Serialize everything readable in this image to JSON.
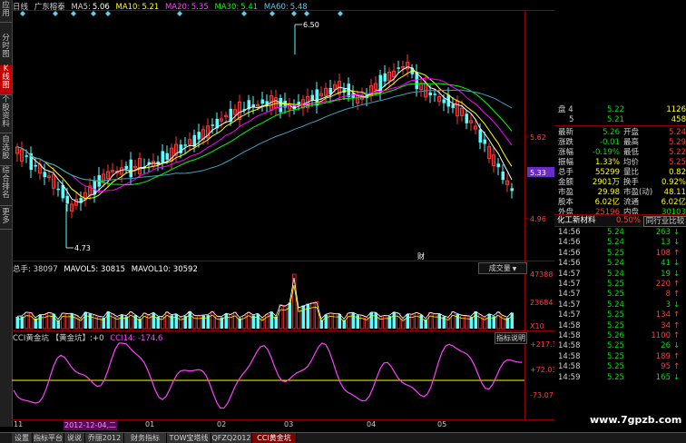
{
  "header": {
    "period": "日线",
    "stock_name": "广东榕泰",
    "ma5_label": "MA5:",
    "ma5": "5.06",
    "ma10_label": "MA10:",
    "ma10": "5.21",
    "ma20_label": "MA20:",
    "ma20": "5.35",
    "ma30_label": "MA30:",
    "ma30": "5.41",
    "ma60_label": "MA60:",
    "ma60": "5.48"
  },
  "left_tabs": [
    "应用",
    "分时图",
    "K线图",
    "个股资料",
    "自选股",
    "综合排名",
    "更多"
  ],
  "price_axis": {
    "hi": "5.62",
    "cur": "5.33",
    "lo": "4.96"
  },
  "annotations": {
    "high": "6.50",
    "low": "4.73",
    "marker": "财"
  },
  "volume": {
    "label": "总手: 38097",
    "mavol5": "MAVOL5: 30815",
    "mavol10": "MAVOL10: 30592",
    "button": "成交量",
    "axis_top": "47388",
    "axis_mid": "23684",
    "axis_unit": "X10"
  },
  "cci": {
    "title": "CCI黄金坑 【黄金坑】:+0",
    "cci14": "CCI14: -174.6",
    "button": "指标说明",
    "axis_top": "+217.1",
    "axis_mid": "+72.03",
    "axis_bot": "-73.07"
  },
  "date_axis": {
    "labels": [
      "11",
      "2012-12-04,二",
      "01",
      "02",
      "03",
      "04",
      "05"
    ],
    "colors": {
      "selected": "#ff00ff",
      "normal": "#c8c8c8"
    }
  },
  "quote_panel": {
    "top_rows": [
      {
        "label": "盘 4",
        "price": "5.22",
        "vol": "1126"
      },
      {
        "label": "5",
        "price": "5.21",
        "vol": "458"
      }
    ],
    "stats": [
      {
        "l1": "最新",
        "v1": "5.26",
        "l2": "开盘",
        "v2": "5.24"
      },
      {
        "l1": "涨跌",
        "v1": "-0.01",
        "l2": "最高",
        "v2": "5.29"
      },
      {
        "l1": "涨幅",
        "v1": "-0.19%",
        "l2": "最低",
        "v2": "5.22"
      },
      {
        "l1": "振幅",
        "v1": "1.33%",
        "l2": "均价",
        "v2": "5.25"
      },
      {
        "l1": "总手",
        "v1": "55299",
        "l2": "量比",
        "v2": "0.82"
      },
      {
        "l1": "金额",
        "v1": "2901万",
        "l2": "换手",
        "v2": "0.92%"
      },
      {
        "l1": "市盈",
        "v1": "29.98",
        "l2": "市盈(动)",
        "v2": "48.11"
      },
      {
        "l1": "股本",
        "v1": "6.02亿",
        "l2": "流通",
        "v2": "6.02亿"
      },
      {
        "l1": "外盘",
        "v1": "25196",
        "l2": "内盘",
        "v2": "30103"
      }
    ],
    "industry": {
      "name": "化工新材料",
      "pct": "0.50%",
      "link": "同行业比较"
    },
    "ticks": [
      {
        "time": "14:56",
        "price": "5.24",
        "vol": "263",
        "dir": "down"
      },
      {
        "time": "14:56",
        "price": "5.24",
        "vol": "13",
        "dir": "down"
      },
      {
        "time": "14:56",
        "price": "5.25",
        "vol": "108",
        "dir": "up"
      },
      {
        "time": "14:56",
        "price": "5.24",
        "vol": "41",
        "dir": "down"
      },
      {
        "time": "14:57",
        "price": "5.24",
        "vol": "19",
        "dir": "down"
      },
      {
        "time": "14:57",
        "price": "5.25",
        "vol": "220",
        "dir": "up"
      },
      {
        "time": "14:57",
        "price": "5.25",
        "vol": "8",
        "dir": "up"
      },
      {
        "time": "14:57",
        "price": "5.24",
        "vol": "3",
        "dir": "down"
      },
      {
        "time": "14:57",
        "price": "5.25",
        "vol": "134",
        "dir": "up"
      },
      {
        "time": "14:58",
        "price": "5.25",
        "vol": "34",
        "dir": "up"
      },
      {
        "time": "14:58",
        "price": "5.26",
        "vol": "1100",
        "dir": "up"
      },
      {
        "time": "14:58",
        "price": "5.25",
        "vol": "26",
        "dir": "down"
      },
      {
        "time": "14:58",
        "price": "5.25",
        "vol": "189",
        "dir": "up"
      },
      {
        "time": "14:58",
        "price": "5.25",
        "vol": "95",
        "dir": "up"
      },
      {
        "time": "14:59",
        "price": "5.25",
        "vol": "165",
        "dir": "down"
      }
    ]
  },
  "bottom_tabs": [
    "设置",
    "指标平台",
    "说说",
    "乔丽2012",
    "财务指标",
    "TOW宝塔线",
    "QFZQ2012",
    "CCI黄金坑"
  ],
  "watermark": "www.7gpzb.com",
  "colors": {
    "up": "#ff3232",
    "down": "#54ffff",
    "ma5": "#ffffff",
    "ma10": "#ffff00",
    "ma20": "#ff00ff",
    "ma30": "#00ff00",
    "ma60": "#40a0c0",
    "cci": "#ff40ff",
    "zero": "#ffff00"
  }
}
